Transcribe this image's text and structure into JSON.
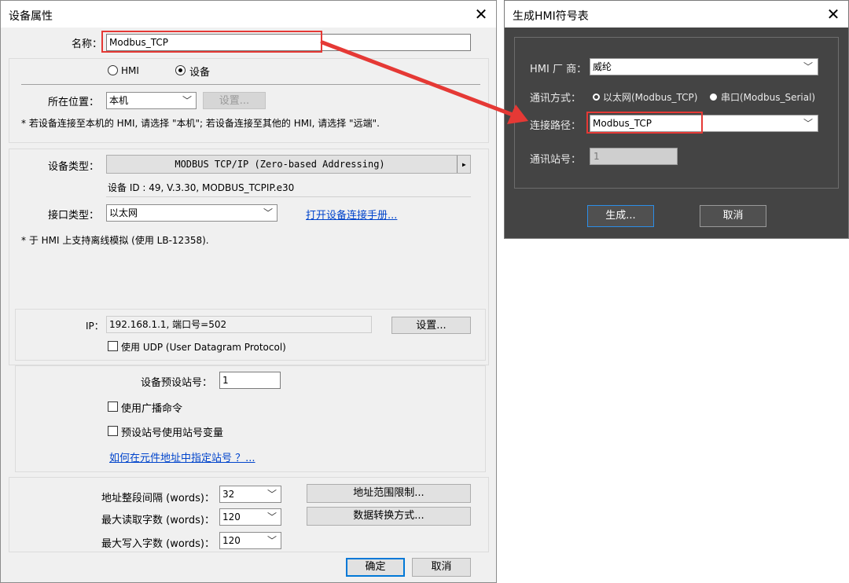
{
  "device_dialog": {
    "title": "设备属性",
    "name_label": "名称：",
    "name_value": "Modbus_TCP",
    "radio_hmi": "HMI",
    "radio_device": "设备",
    "location_label": "所在位置：",
    "location_value": "本机",
    "location_settings_button": "设置...",
    "location_note": "* 若设备连接至本机的 HMI, 请选择 \"本机\"; 若设备连接至其他的 HMI, 请选择 \"远端\".",
    "device_type_label": "设备类型：",
    "device_type_value": "MODBUS TCP/IP (Zero-based Addressing)",
    "device_type_arrow": "▸",
    "device_info": "设备 ID : 49, V.3.30, MODBUS_TCPIP.e30",
    "interface_label": "接口类型：",
    "interface_value": "以太网",
    "manual_link": "打开设备连接手册...",
    "offline_note": "* 于 HMI 上支持离线模拟 (使用 LB-12358).",
    "ip_label": "IP：",
    "ip_value": "192.168.1.1,  端口号=502",
    "ip_settings_button": "设置...",
    "udp_label": "使用 UDP (User Datagram Protocol)",
    "default_station_label": "设备预设站号：",
    "default_station_value": "1",
    "broadcast_label": "使用广播命令",
    "station_var_label": "预设站号使用站号变量",
    "station_help_link": "如何在元件地址中指定站号 ？...",
    "addr_interval_label": "地址整段间隔 (words)：",
    "addr_interval_value": "32",
    "max_read_label": "最大读取字数 (words)：",
    "max_read_value": "120",
    "max_write_label": "最大写入字数 (words)：",
    "max_write_value": "120",
    "addr_limit_button": "地址范围限制...",
    "data_convert_button": "数据转换方式...",
    "ok_button": "确定",
    "cancel_button": "取消"
  },
  "hmi_dialog": {
    "title": "生成HMI符号表",
    "vendor_label": "HMI 厂 商：",
    "vendor_value": "威纶",
    "comm_label": "通讯方式：",
    "comm_option1": "以太网(Modbus_TCP)",
    "comm_option2": "串口(Modbus_Serial)",
    "path_label": "连接路径：",
    "path_value": "Modbus_TCP",
    "station_label": "通讯站号：",
    "station_value": "1",
    "generate_button": "生成...",
    "cancel_button": "取消"
  },
  "icons": {
    "close": "✕",
    "chevron": "﹀"
  },
  "colors": {
    "highlight": "#e53935",
    "link": "#0044cc",
    "dark_bg": "#444444",
    "accent": "#0078d7"
  }
}
